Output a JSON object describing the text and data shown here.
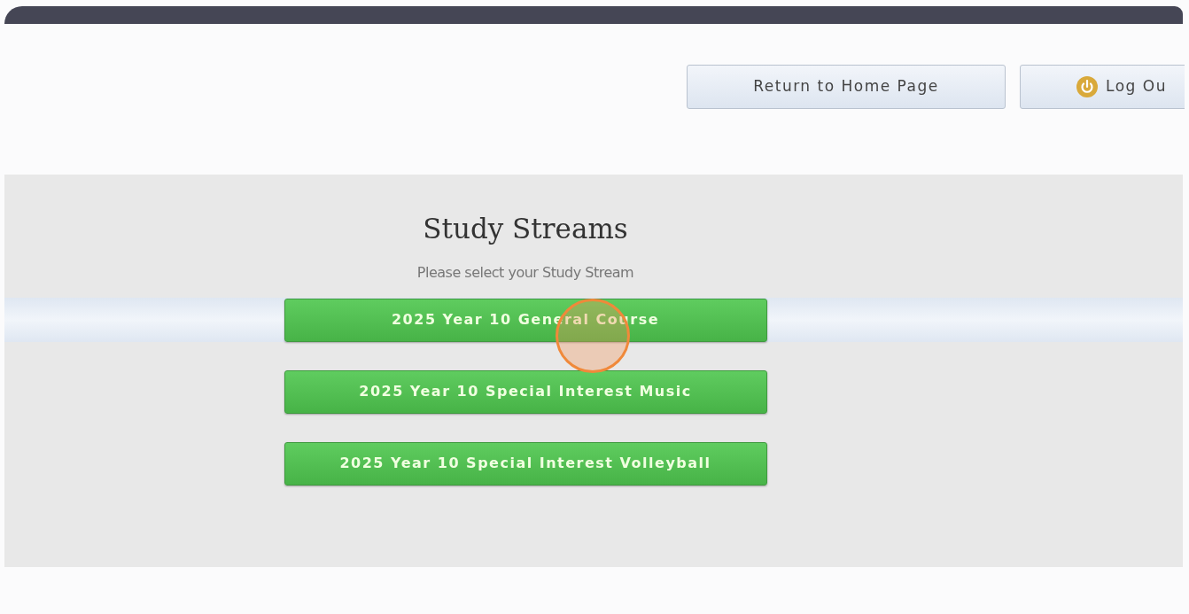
{
  "header": {
    "buttons": [
      {
        "kind": "home",
        "label": "Return to Home Page"
      },
      {
        "kind": "logout",
        "label": "Log Ou"
      }
    ]
  },
  "panel": {
    "title": "Study Streams",
    "subtitle": "Please select your Study Stream",
    "streams": [
      {
        "label": "2025 Year 10 General Course",
        "highlighted": true
      },
      {
        "label": "2025 Year 10 Special Interest Music",
        "highlighted": false
      },
      {
        "label": "2025 Year 10 Special Interest Volleyball",
        "highlighted": false
      }
    ]
  }
}
